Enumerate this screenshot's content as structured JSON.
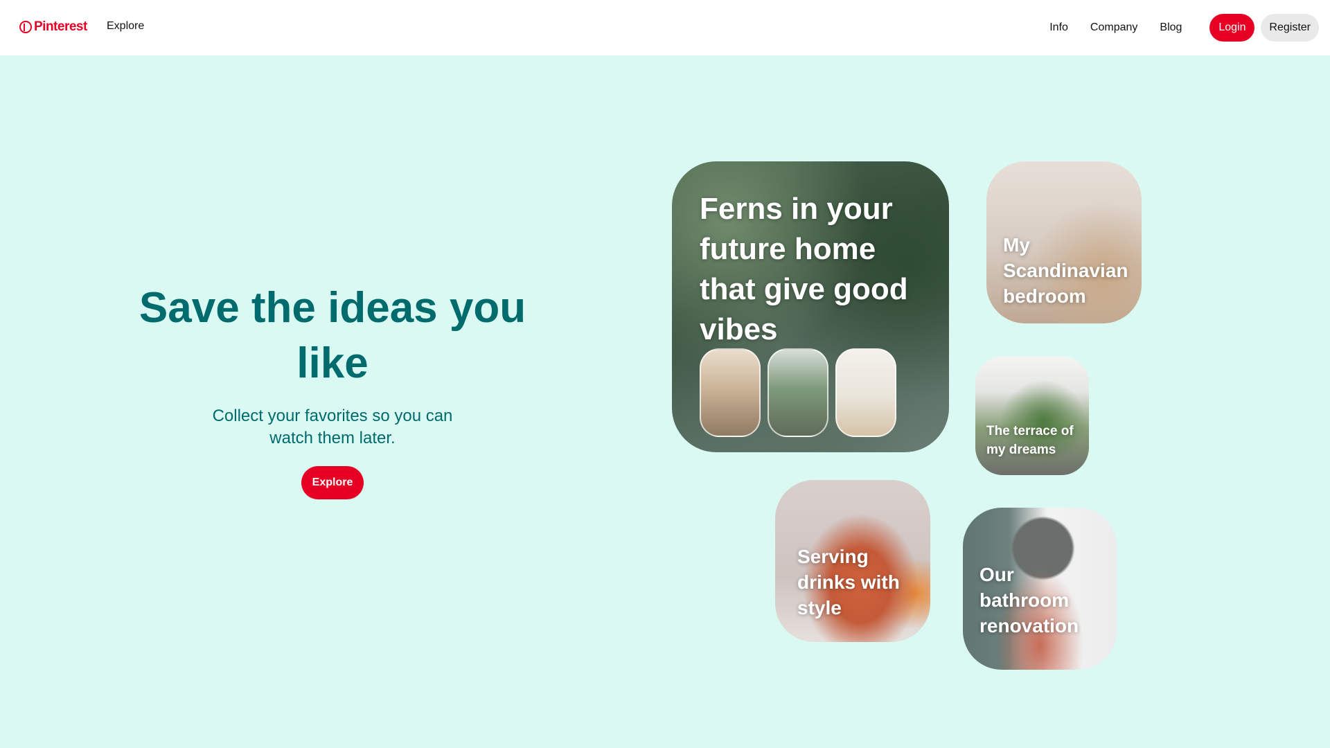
{
  "header": {
    "logo_text": "Pinterest",
    "nav_explore": "Explore",
    "links": [
      "Info",
      "Company",
      "Blog"
    ],
    "login_label": "Login",
    "register_label": "Register"
  },
  "hero": {
    "title": "Save the ideas you like",
    "subtitle": "Collect your favorites so you can watch them later.",
    "button_label": "Explore"
  },
  "cards": {
    "ferns": "Ferns in your future home that give good vibes",
    "scandinavian": "My Scandinavian bedroom",
    "terrace": "The terrace of my dreams",
    "drinks": "Serving drinks with style",
    "bathroom": "Our bathroom renovation"
  },
  "colors": {
    "brand_red": "#e60023",
    "hero_text": "#006b6c",
    "background": "#daf9f3",
    "register_bg": "#e9e9e9"
  }
}
